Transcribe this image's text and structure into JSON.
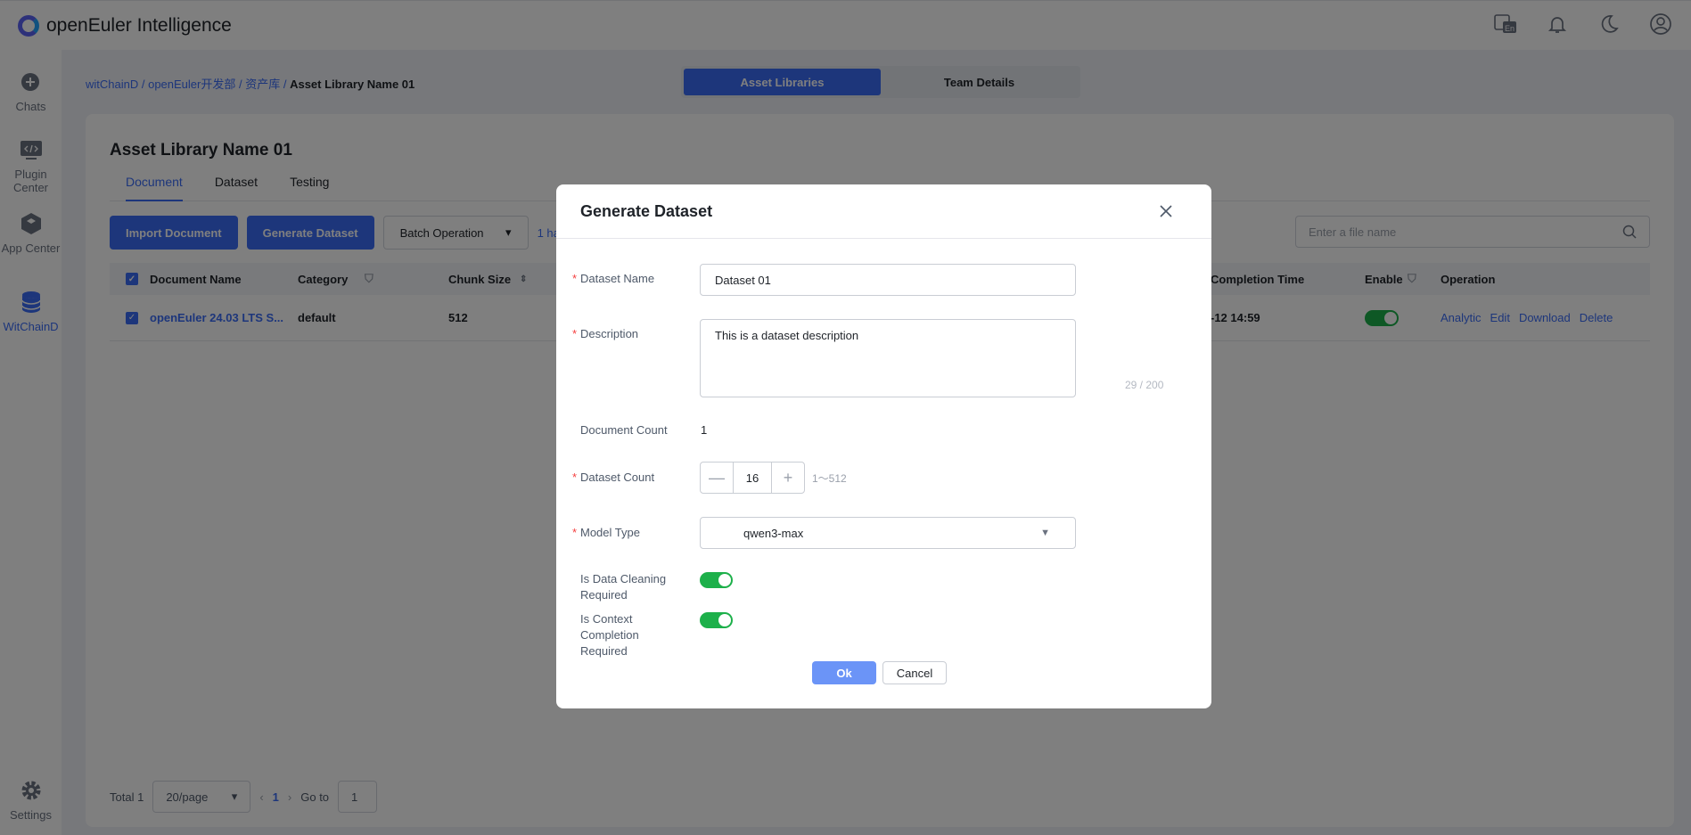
{
  "app": {
    "title": "openEuler Intelligence"
  },
  "top_icons": [
    "language-en-icon",
    "bell-icon",
    "moon-icon",
    "user-icon"
  ],
  "sidebar": {
    "items": [
      {
        "label": "Chats",
        "icon": "chat-plus-icon"
      },
      {
        "label": "Plugin Center",
        "icon": "code-plugin-icon"
      },
      {
        "label": "App Center",
        "icon": "cube-icon"
      },
      {
        "label": "WitChainD",
        "icon": "database-icon",
        "active": true
      },
      {
        "label": "Settings",
        "icon": "gear-icon"
      }
    ]
  },
  "breadcrumb": {
    "items": [
      "witChainD",
      "openEuler开发部",
      "资产库"
    ],
    "current": "Asset Library Name 01"
  },
  "segment": {
    "tabs": [
      "Asset Libraries",
      "Team Details"
    ],
    "active": 0
  },
  "library": {
    "title": "Asset Library Name 01",
    "tabs": [
      "Document",
      "Dataset",
      "Testing"
    ],
    "buttons": {
      "import": "Import Document",
      "generate": "Generate Dataset",
      "batch": "Batch Operation"
    },
    "selection_hint": "1 ha",
    "search_placeholder": "Enter a file name",
    "columns": {
      "name": "Document Name",
      "category": "Category",
      "chunk": "Chunk Size",
      "completion": "Completion Time",
      "enable": "Enable",
      "operation": "Operation"
    },
    "rows": [
      {
        "name": "openEuler 24.03 LTS S...",
        "category": "default",
        "chunk": "512",
        "completion": "-12 14:59",
        "enabled": true,
        "ops": [
          "Analytic",
          "Edit",
          "Download",
          "Delete"
        ]
      }
    ],
    "pager": {
      "total": "Total 1",
      "per_page": "20/page",
      "page": "1",
      "goto_label": "Go to",
      "goto_value": "1"
    }
  },
  "modal": {
    "title": "Generate Dataset",
    "dataset_name": {
      "label": "Dataset Name",
      "value": "Dataset 01"
    },
    "description": {
      "label": "Description",
      "value": "This is a dataset description",
      "counter": "29 / 200"
    },
    "document_count": {
      "label": "Document Count",
      "value": "1"
    },
    "dataset_count": {
      "label": "Dataset Count",
      "value": "16",
      "minus": "—",
      "plus": "+",
      "range": "1〜512"
    },
    "model_type": {
      "label": "Model Type",
      "value": "qwen3-max"
    },
    "data_cleaning": {
      "label": "Is Data Cleaning Required",
      "on": true
    },
    "context_completion": {
      "label": "Is Context Completion Required",
      "on": true
    },
    "ok": "Ok",
    "cancel": "Cancel",
    "required_mark": "*"
  },
  "colors": {
    "accent": "#3b6cf6",
    "toggle_on": "#1db04a",
    "required": "#f53f3f"
  }
}
